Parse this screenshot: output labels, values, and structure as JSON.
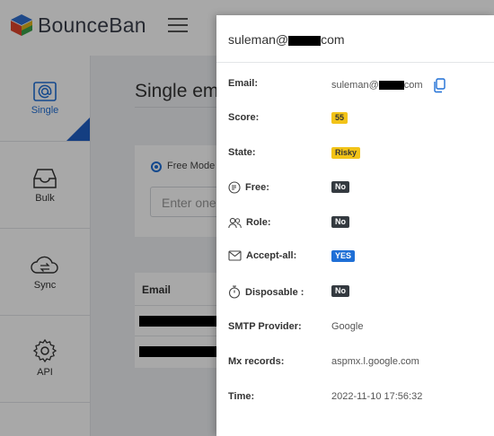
{
  "app": {
    "name": "BounceBan"
  },
  "sidebar": {
    "items": [
      {
        "label": "Single",
        "icon": "at-sign-icon",
        "active": true
      },
      {
        "label": "Bulk",
        "icon": "inbox-icon"
      },
      {
        "label": "Sync",
        "icon": "cloud-sync-icon"
      },
      {
        "label": "API",
        "icon": "gear-icon"
      }
    ]
  },
  "main": {
    "title": "Single em",
    "mode_label": "Free Mode",
    "input_placeholder": "Enter one",
    "table_header": "Email"
  },
  "panel": {
    "title_prefix": "suleman@",
    "title_suffix": "com",
    "rows": [
      {
        "label": "Email:",
        "value_prefix": "suleman@",
        "value_suffix": "com"
      },
      {
        "label": "Score:",
        "value": "55"
      },
      {
        "label": "State:",
        "value": "Risky"
      },
      {
        "label": "Free:",
        "value": "No"
      },
      {
        "label": "Role:",
        "value": "No"
      },
      {
        "label": "Accept-all:",
        "value": "YES"
      },
      {
        "label": "Disposable :",
        "value": "No"
      },
      {
        "label": "SMTP Provider:",
        "value": "Google"
      },
      {
        "label": "Mx records:",
        "value": "aspmx.l.google.com"
      },
      {
        "label": "Time:",
        "value": "2022-11-10 17:56:32"
      }
    ]
  },
  "colors": {
    "accent": "#1f6fd6",
    "badge_yellow": "#f2c318",
    "badge_dark": "#343a40",
    "badge_blue": "#1f6fd6"
  }
}
